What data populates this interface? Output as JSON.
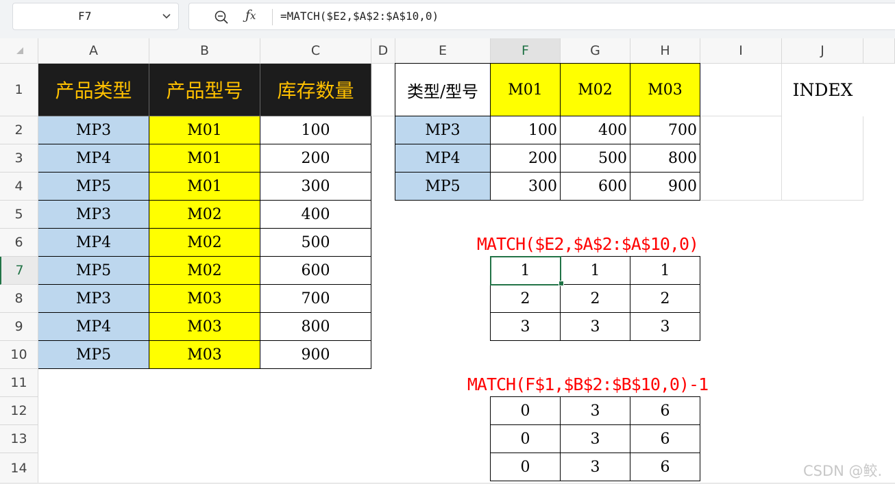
{
  "name_box": "F7",
  "formula_bar": {
    "formula": "=MATCH($E2,$A$2:$A$10,0)"
  },
  "columns": [
    "A",
    "B",
    "C",
    "D",
    "E",
    "F",
    "G",
    "H",
    "I",
    "J"
  ],
  "rows": [
    "1",
    "2",
    "3",
    "4",
    "5",
    "6",
    "7",
    "8",
    "9",
    "10",
    "11",
    "12",
    "13",
    "14"
  ],
  "left_table": {
    "headers": [
      "产品类型",
      "产品型号",
      "库存数量"
    ],
    "rows": [
      [
        "MP3",
        "M01",
        "100"
      ],
      [
        "MP4",
        "M01",
        "200"
      ],
      [
        "MP5",
        "M01",
        "300"
      ],
      [
        "MP3",
        "M02",
        "400"
      ],
      [
        "MP4",
        "M02",
        "500"
      ],
      [
        "MP5",
        "M02",
        "600"
      ],
      [
        "MP3",
        "M03",
        "700"
      ],
      [
        "MP4",
        "M03",
        "800"
      ],
      [
        "MP5",
        "M03",
        "900"
      ]
    ]
  },
  "cross_table": {
    "corner": "类型/型号",
    "col_headers": [
      "M01",
      "M02",
      "M03"
    ],
    "row_headers": [
      "MP3",
      "MP4",
      "MP5"
    ],
    "values": [
      [
        "100",
        "400",
        "700"
      ],
      [
        "200",
        "500",
        "800"
      ],
      [
        "300",
        "600",
        "900"
      ]
    ]
  },
  "index_label": "INDEX",
  "match_row_table": {
    "label": "MATCH($E2,$A$2:$A$10,0)",
    "values": [
      [
        "1",
        "1",
        "1"
      ],
      [
        "2",
        "2",
        "2"
      ],
      [
        "3",
        "3",
        "3"
      ]
    ]
  },
  "match_col_table": {
    "label": "MATCH(F$1,$B$2:$B$10,0)-1",
    "values": [
      [
        "0",
        "3",
        "6"
      ],
      [
        "0",
        "3",
        "6"
      ],
      [
        "0",
        "3",
        "6"
      ]
    ]
  },
  "watermark": "CSDN @鲛.",
  "colors": {
    "header_black": "#1c1c1c",
    "header_gold": "#ffc000",
    "light_blue": "#bdd7ee",
    "yellow": "#ffff00",
    "formula_red": "#ff0000",
    "selection_green": "#217346"
  },
  "icons": [
    "chevron-down-icon",
    "zoom-icon",
    "fx-icon"
  ]
}
